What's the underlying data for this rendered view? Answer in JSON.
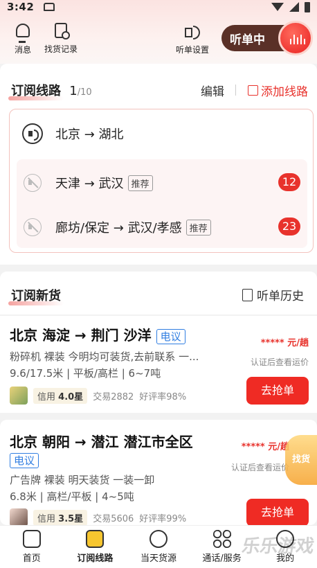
{
  "status": {
    "time": "3:42"
  },
  "toolbar": {
    "messages": "消息",
    "search_history": "找货记录",
    "listen_settings": "听单设置",
    "listening": "听单中"
  },
  "routes": {
    "title": "订阅线路",
    "count": "1",
    "max": "/10",
    "edit": "编辑",
    "add": "添加线路",
    "items": [
      {
        "route": "北京 → 湖北",
        "tag": "",
        "count": ""
      },
      {
        "route": "天津 → 武汉",
        "tag": "推荐",
        "count": "12"
      },
      {
        "route": "廊坊/保定 → 武汉/孝感",
        "tag": "推荐",
        "count": "23"
      }
    ]
  },
  "goods": {
    "title": "订阅新货",
    "history": "听单历史",
    "items": [
      {
        "route": "北京 海淀 → 荆门 沙洋",
        "tag": "电议",
        "desc": "粉碎机 裸装 今明均可装货,去前联系 一...",
        "spec": "9.6/17.5米 | 平板/高栏 | 6~7吨",
        "price": "***** 元/趟",
        "note": "认证后查看运价",
        "grab": "去抢单",
        "credit_label": "信用",
        "credit": "4.0星",
        "trades": "交易2882",
        "rating": "好评率98%"
      },
      {
        "route": "北京 朝阳 → 潜江 潜江市全区",
        "tag": "电议",
        "desc": "广告牌 裸装 明天装货 一装一卸",
        "spec": "6.8米 | 高栏/平板 | 4~5吨",
        "price": "***** 元/趟",
        "note": "认证后查看运价",
        "grab": "去抢单",
        "credit_label": "信用",
        "credit": "3.5星",
        "trades": "交易5606",
        "rating": "好评率99%"
      }
    ]
  },
  "float_badge": "找货",
  "tabs": [
    {
      "label": "首页"
    },
    {
      "label": "订阅线路"
    },
    {
      "label": "当天货源"
    },
    {
      "label": "通话/服务"
    },
    {
      "label": "我的"
    }
  ],
  "watermark": "乐乐游戏"
}
